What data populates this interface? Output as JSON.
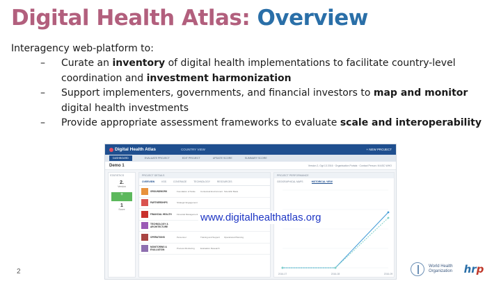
{
  "slide": {
    "title_part1": "Digital Health Atlas: ",
    "title_part2": "Overview",
    "intro": "Interagency web-platform to:",
    "bullets": [
      {
        "dash": "–",
        "pre": "Curate an ",
        "b1": "inventory",
        "mid": " of digital health implementations to facilitate country-level coordination and ",
        "b2": "investment harmonization",
        "post": ""
      },
      {
        "dash": "–",
        "pre": "Support implementers, governments, and financial investors to ",
        "b1": "map and monitor",
        "mid": " digital health investments",
        "b2": "",
        "post": ""
      },
      {
        "dash": "–",
        "pre": "Provide appropriate assessment frameworks to evaluate ",
        "b1": "scale and interoperability",
        "mid": "",
        "b2": "",
        "post": ""
      }
    ],
    "url": "www.digitalhealthatlas.org",
    "page_number": "2",
    "who_text_line1": "World Health",
    "who_text_line2": "Organization",
    "hrp_h": "h",
    "hrp_r": "r",
    "hrp_p": "p"
  },
  "screenshot": {
    "logo": "Digital Health Atlas",
    "country_view": "COUNTRY VIEW",
    "new_project": "+ NEW PROJECT",
    "nav": [
      "DASHBOARD",
      "EVALUATE PROJECT",
      "EDIT PROJECT",
      "UPDATE SCORE",
      "SUMMARY SCORE"
    ],
    "demo": "Demo 1",
    "meta": "Version 2, Ogt 13 2016 · Organisation Portals · Contact Person: M ASC WHO",
    "statistics": "STATISTICS",
    "stat_version_value": "2.",
    "stat_version_label": "Version",
    "stat_add_label": "+",
    "stat_score_value": "1",
    "stat_score_label": "Score",
    "details_header": "PROJECT DETAILS",
    "details_tabs": [
      "OVERVIEW",
      "KSS",
      "COVERAGE",
      "TECHNOLOGY",
      "RESOURCES"
    ],
    "rows": [
      {
        "name": "GROUNDWORK",
        "c1": "Foundation of Scale",
        "c2": "Contextual Environment",
        "c3": "Scientific Basis",
        "color": "#e8913c"
      },
      {
        "name": "PARTNERSHIPS",
        "c1": "Strategic Engagement",
        "c2": "",
        "c3": "",
        "color": "#d9534f"
      },
      {
        "name": "FINANCIAL HEALTH",
        "c1": "Financial Management",
        "c2": "",
        "c3": "",
        "color": "#c9302c"
      },
      {
        "name": "TECHNOLOGY & ARCHITECTURE",
        "c1": "",
        "c2": "",
        "c3": "",
        "color": "#9b59b6"
      },
      {
        "name": "OPERATIONS",
        "c1": "Personnel",
        "c2": "Training and Support",
        "c3": "Operational Planning",
        "color": "#a94442"
      },
      {
        "name": "MONITORING & EVALUATION",
        "c1": "Process Monitoring",
        "c2": "Evaluation Research",
        "c3": "",
        "color": "#8e6fb0"
      }
    ],
    "perf_header": "PROJECT PERFORMANCE",
    "perf_tabs": [
      "GEOGRAPHICAL MAPS",
      "HISTORICAL VIEW"
    ],
    "colors": {
      "top": "#1f4f8f",
      "green": "#5cb85c",
      "line1": "#3f9ad6",
      "line2": "#7ed0c6"
    }
  },
  "chart_data": {
    "type": "line",
    "x": [
      "2016-07",
      "2016-08",
      "2016-09"
    ],
    "series": [
      {
        "values": [
          0,
          0,
          10
        ]
      },
      {
        "values": [
          0,
          0,
          9
        ]
      }
    ],
    "ylim": [
      0,
      14
    ]
  }
}
